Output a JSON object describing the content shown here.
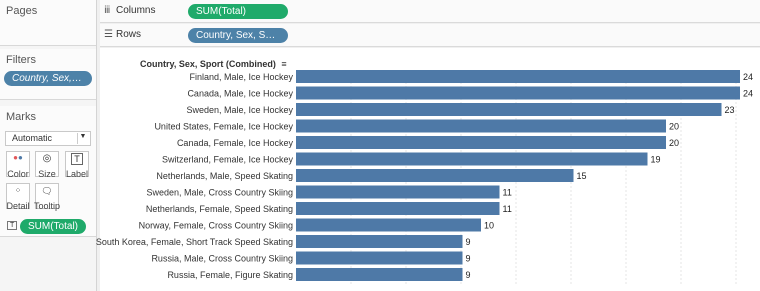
{
  "sidebar": {
    "pages_title": "Pages",
    "filters_title": "Filters",
    "filter_pill": "Country, Sex, Spor..",
    "marks_title": "Marks",
    "marks_type": "Automatic",
    "buttons": [
      {
        "label": "Color",
        "icon": "color-dots-icon"
      },
      {
        "label": "Size",
        "icon": "size-icon"
      },
      {
        "label": "Label",
        "icon": "label-icon"
      },
      {
        "label": "Detail",
        "icon": "detail-icon"
      },
      {
        "label": "Tooltip",
        "icon": "tooltip-icon"
      }
    ],
    "sum_pill": "SUM(Total)"
  },
  "shelves": {
    "columns_label": "Columns",
    "columns_pill": "SUM(Total)",
    "rows_label": "Rows",
    "rows_pill": "Country, Sex, Spor.."
  },
  "chart_data": {
    "type": "bar",
    "orientation": "horizontal",
    "header": "Country, Sex, Sport (Combined)",
    "color": "#4e79a7",
    "categories": [
      "Finland, Male, Ice Hockey",
      "Canada, Male, Ice Hockey",
      "Sweden, Male, Ice Hockey",
      "United States, Female, Ice Hockey",
      "Canada, Female, Ice Hockey",
      "Switzerland, Female, Ice Hockey",
      "Netherlands, Male, Speed Skating",
      "Sweden, Male, Cross Country Skiing",
      "Netherlands, Female, Speed Skating",
      "Norway, Female, Cross Country Skiing",
      "South Korea, Female, Short Track Speed Skating",
      "Russia, Male, Cross Country Skiing",
      "Russia, Female, Figure Skating"
    ],
    "values": [
      24,
      24,
      23,
      20,
      20,
      19,
      15,
      11,
      11,
      10,
      9,
      9,
      9
    ],
    "xlim": [
      0,
      24
    ]
  }
}
